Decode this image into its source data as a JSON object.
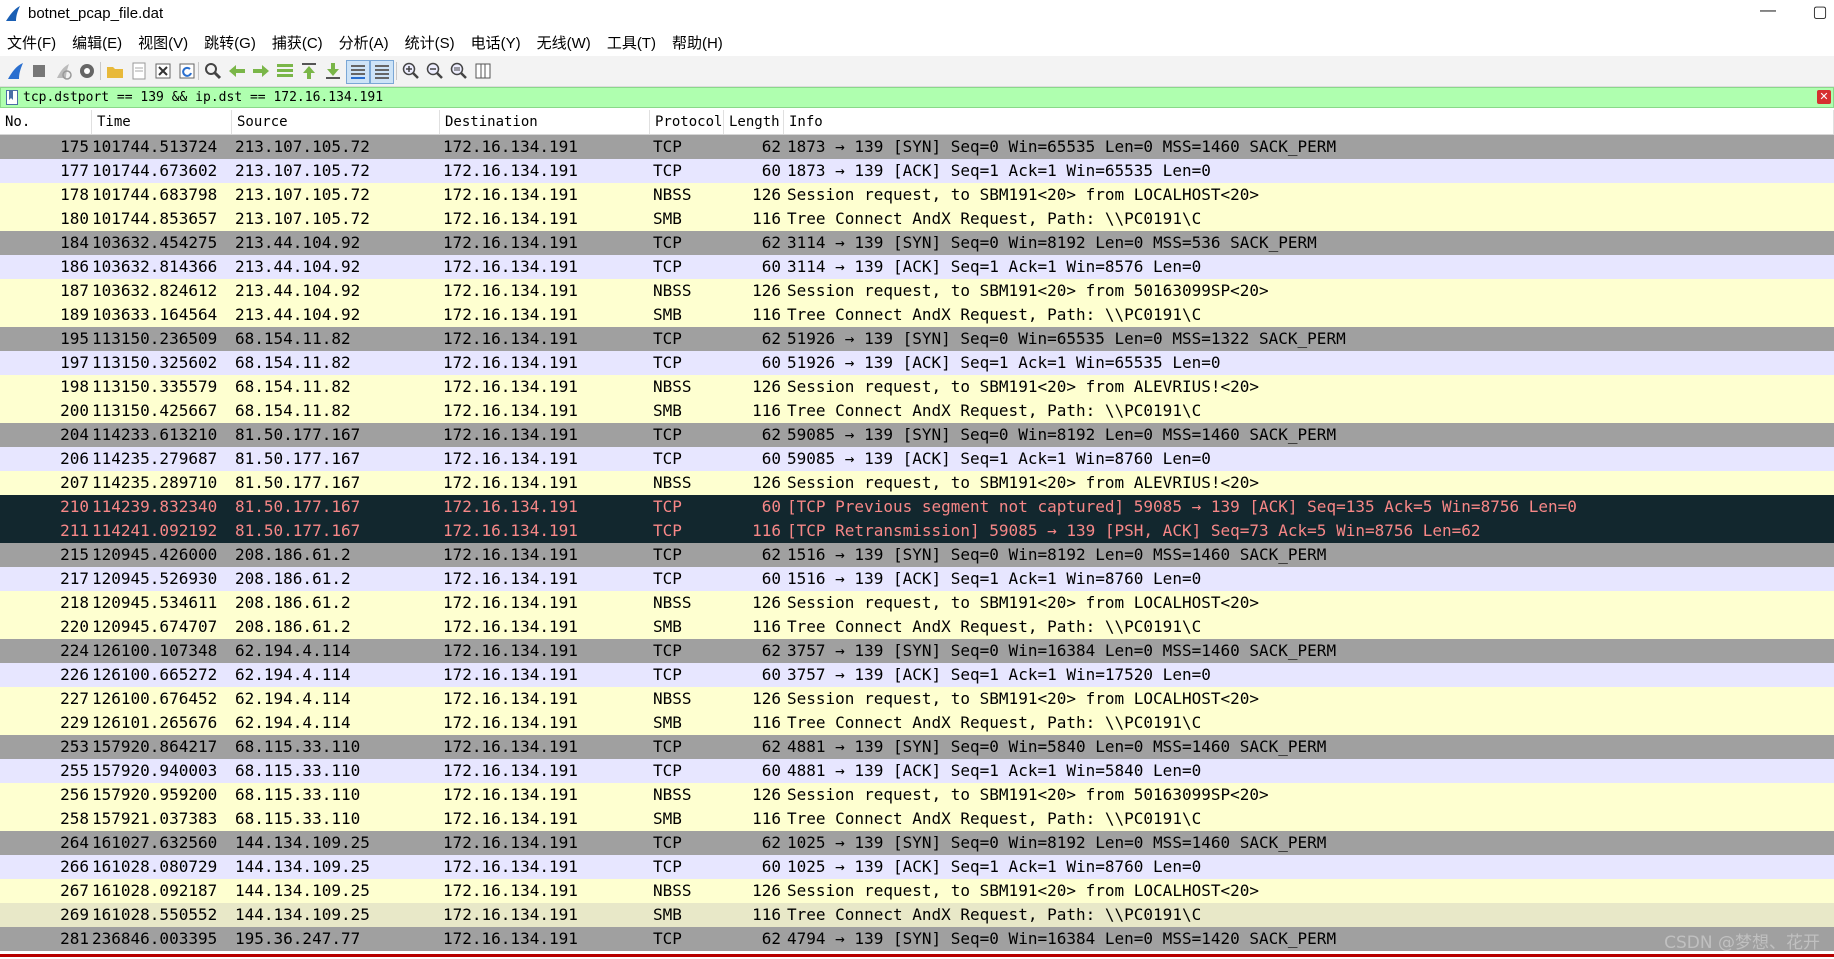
{
  "window": {
    "title": "botnet_pcap_file.dat",
    "minimize": "—",
    "restore": "▢"
  },
  "menu": [
    "文件(F)",
    "编辑(E)",
    "视图(V)",
    "跳转(G)",
    "捕获(C)",
    "分析(A)",
    "统计(S)",
    "电话(Y)",
    "无线(W)",
    "工具(T)",
    "帮助(H)"
  ],
  "filter": {
    "value": "tcp.dstport == 139 && ip.dst == 172.16.134.191"
  },
  "columns": [
    "No.",
    "Time",
    "Source",
    "Destination",
    "Protocol",
    "Length",
    "Info"
  ],
  "colors": {
    "syn_bg": "#a0a0a0",
    "ack_bg": "#e7e6ff",
    "nbss_bg": "#feffd0",
    "smb_bg": "#feffd0",
    "err_bg": "#12272e",
    "err_fg": "#f78787",
    "last_smb_bg": "#e8e8c8",
    "filter_bg": "#afffaf"
  },
  "packets": [
    {
      "no": "175",
      "time": "101744.513724",
      "src": "213.107.105.72",
      "dst": "172.16.134.191",
      "proto": "TCP",
      "len": "62",
      "info": "1873 → 139 [SYN] Seq=0 Win=65535 Len=0 MSS=1460 SACK_PERM",
      "style": "syn"
    },
    {
      "no": "177",
      "time": "101744.673602",
      "src": "213.107.105.72",
      "dst": "172.16.134.191",
      "proto": "TCP",
      "len": "60",
      "info": "1873 → 139 [ACK] Seq=1 Ack=1 Win=65535 Len=0",
      "style": "ack"
    },
    {
      "no": "178",
      "time": "101744.683798",
      "src": "213.107.105.72",
      "dst": "172.16.134.191",
      "proto": "NBSS",
      "len": "126",
      "info": "Session request, to SBM191<20> from LOCALHOST<20>",
      "style": "nbss"
    },
    {
      "no": "180",
      "time": "101744.853657",
      "src": "213.107.105.72",
      "dst": "172.16.134.191",
      "proto": "SMB",
      "len": "116",
      "info": "Tree Connect AndX Request, Path: \\\\PC0191\\C",
      "style": "smb"
    },
    {
      "no": "184",
      "time": "103632.454275",
      "src": "213.44.104.92",
      "dst": "172.16.134.191",
      "proto": "TCP",
      "len": "62",
      "info": "3114 → 139 [SYN] Seq=0 Win=8192 Len=0 MSS=536 SACK_PERM",
      "style": "syn"
    },
    {
      "no": "186",
      "time": "103632.814366",
      "src": "213.44.104.92",
      "dst": "172.16.134.191",
      "proto": "TCP",
      "len": "60",
      "info": "3114 → 139 [ACK] Seq=1 Ack=1 Win=8576 Len=0",
      "style": "ack"
    },
    {
      "no": "187",
      "time": "103632.824612",
      "src": "213.44.104.92",
      "dst": "172.16.134.191",
      "proto": "NBSS",
      "len": "126",
      "info": "Session request, to SBM191<20> from 50163099SP<20>",
      "style": "nbss"
    },
    {
      "no": "189",
      "time": "103633.164564",
      "src": "213.44.104.92",
      "dst": "172.16.134.191",
      "proto": "SMB",
      "len": "116",
      "info": "Tree Connect AndX Request, Path: \\\\PC0191\\C",
      "style": "smb"
    },
    {
      "no": "195",
      "time": "113150.236509",
      "src": "68.154.11.82",
      "dst": "172.16.134.191",
      "proto": "TCP",
      "len": "62",
      "info": "51926 → 139 [SYN] Seq=0 Win=65535 Len=0 MSS=1322 SACK_PERM",
      "style": "syn"
    },
    {
      "no": "197",
      "time": "113150.325602",
      "src": "68.154.11.82",
      "dst": "172.16.134.191",
      "proto": "TCP",
      "len": "60",
      "info": "51926 → 139 [ACK] Seq=1 Ack=1 Win=65535 Len=0",
      "style": "ack"
    },
    {
      "no": "198",
      "time": "113150.335579",
      "src": "68.154.11.82",
      "dst": "172.16.134.191",
      "proto": "NBSS",
      "len": "126",
      "info": "Session request, to SBM191<20> from ALEVRIUS!<20>",
      "style": "nbss"
    },
    {
      "no": "200",
      "time": "113150.425667",
      "src": "68.154.11.82",
      "dst": "172.16.134.191",
      "proto": "SMB",
      "len": "116",
      "info": "Tree Connect AndX Request, Path: \\\\PC0191\\C",
      "style": "smb"
    },
    {
      "no": "204",
      "time": "114233.613210",
      "src": "81.50.177.167",
      "dst": "172.16.134.191",
      "proto": "TCP",
      "len": "62",
      "info": "59085 → 139 [SYN] Seq=0 Win=8192 Len=0 MSS=1460 SACK_PERM",
      "style": "syn"
    },
    {
      "no": "206",
      "time": "114235.279687",
      "src": "81.50.177.167",
      "dst": "172.16.134.191",
      "proto": "TCP",
      "len": "60",
      "info": "59085 → 139 [ACK] Seq=1 Ack=1 Win=8760 Len=0",
      "style": "ack"
    },
    {
      "no": "207",
      "time": "114235.289710",
      "src": "81.50.177.167",
      "dst": "172.16.134.191",
      "proto": "NBSS",
      "len": "126",
      "info": "Session request, to SBM191<20> from ALEVRIUS!<20>",
      "style": "nbss"
    },
    {
      "no": "210",
      "time": "114239.832340",
      "src": "81.50.177.167",
      "dst": "172.16.134.191",
      "proto": "TCP",
      "len": "60",
      "info": "[TCP Previous segment not captured] 59085 → 139 [ACK] Seq=135 Ack=5 Win=8756 Len=0",
      "style": "err"
    },
    {
      "no": "211",
      "time": "114241.092192",
      "src": "81.50.177.167",
      "dst": "172.16.134.191",
      "proto": "TCP",
      "len": "116",
      "info": "[TCP Retransmission] 59085 → 139 [PSH, ACK] Seq=73 Ack=5 Win=8756 Len=62",
      "style": "err"
    },
    {
      "no": "215",
      "time": "120945.426000",
      "src": "208.186.61.2",
      "dst": "172.16.134.191",
      "proto": "TCP",
      "len": "62",
      "info": "1516 → 139 [SYN] Seq=0 Win=8192 Len=0 MSS=1460 SACK_PERM",
      "style": "syn"
    },
    {
      "no": "217",
      "time": "120945.526930",
      "src": "208.186.61.2",
      "dst": "172.16.134.191",
      "proto": "TCP",
      "len": "60",
      "info": "1516 → 139 [ACK] Seq=1 Ack=1 Win=8760 Len=0",
      "style": "ack"
    },
    {
      "no": "218",
      "time": "120945.534611",
      "src": "208.186.61.2",
      "dst": "172.16.134.191",
      "proto": "NBSS",
      "len": "126",
      "info": "Session request, to SBM191<20> from LOCALHOST<20>",
      "style": "nbss"
    },
    {
      "no": "220",
      "time": "120945.674707",
      "src": "208.186.61.2",
      "dst": "172.16.134.191",
      "proto": "SMB",
      "len": "116",
      "info": "Tree Connect AndX Request, Path: \\\\PC0191\\C",
      "style": "smb"
    },
    {
      "no": "224",
      "time": "126100.107348",
      "src": "62.194.4.114",
      "dst": "172.16.134.191",
      "proto": "TCP",
      "len": "62",
      "info": "3757 → 139 [SYN] Seq=0 Win=16384 Len=0 MSS=1460 SACK_PERM",
      "style": "syn"
    },
    {
      "no": "226",
      "time": "126100.665272",
      "src": "62.194.4.114",
      "dst": "172.16.134.191",
      "proto": "TCP",
      "len": "60",
      "info": "3757 → 139 [ACK] Seq=1 Ack=1 Win=17520 Len=0",
      "style": "ack"
    },
    {
      "no": "227",
      "time": "126100.676452",
      "src": "62.194.4.114",
      "dst": "172.16.134.191",
      "proto": "NBSS",
      "len": "126",
      "info": "Session request, to SBM191<20> from LOCALHOST<20>",
      "style": "nbss"
    },
    {
      "no": "229",
      "time": "126101.265676",
      "src": "62.194.4.114",
      "dst": "172.16.134.191",
      "proto": "SMB",
      "len": "116",
      "info": "Tree Connect AndX Request, Path: \\\\PC0191\\C",
      "style": "smb"
    },
    {
      "no": "253",
      "time": "157920.864217",
      "src": "68.115.33.110",
      "dst": "172.16.134.191",
      "proto": "TCP",
      "len": "62",
      "info": "4881 → 139 [SYN] Seq=0 Win=5840 Len=0 MSS=1460 SACK_PERM",
      "style": "syn"
    },
    {
      "no": "255",
      "time": "157920.940003",
      "src": "68.115.33.110",
      "dst": "172.16.134.191",
      "proto": "TCP",
      "len": "60",
      "info": "4881 → 139 [ACK] Seq=1 Ack=1 Win=5840 Len=0",
      "style": "ack"
    },
    {
      "no": "256",
      "time": "157920.959200",
      "src": "68.115.33.110",
      "dst": "172.16.134.191",
      "proto": "NBSS",
      "len": "126",
      "info": "Session request, to SBM191<20> from 50163099SP<20>",
      "style": "nbss"
    },
    {
      "no": "258",
      "time": "157921.037383",
      "src": "68.115.33.110",
      "dst": "172.16.134.191",
      "proto": "SMB",
      "len": "116",
      "info": "Tree Connect AndX Request, Path: \\\\PC0191\\C",
      "style": "smb"
    },
    {
      "no": "264",
      "time": "161027.632560",
      "src": "144.134.109.25",
      "dst": "172.16.134.191",
      "proto": "TCP",
      "len": "62",
      "info": "1025 → 139 [SYN] Seq=0 Win=8192 Len=0 MSS=1460 SACK_PERM",
      "style": "syn"
    },
    {
      "no": "266",
      "time": "161028.080729",
      "src": "144.134.109.25",
      "dst": "172.16.134.191",
      "proto": "TCP",
      "len": "60",
      "info": "1025 → 139 [ACK] Seq=1 Ack=1 Win=8760 Len=0",
      "style": "ack"
    },
    {
      "no": "267",
      "time": "161028.092187",
      "src": "144.134.109.25",
      "dst": "172.16.134.191",
      "proto": "NBSS",
      "len": "126",
      "info": "Session request, to SBM191<20> from LOCALHOST<20>",
      "style": "nbss"
    },
    {
      "no": "269",
      "time": "161028.550552",
      "src": "144.134.109.25",
      "dst": "172.16.134.191",
      "proto": "SMB",
      "len": "116",
      "info": "Tree Connect AndX Request, Path: \\\\PC0191\\C",
      "style": "smb_last"
    },
    {
      "no": "281",
      "time": "236846.003395",
      "src": "195.36.247.77",
      "dst": "172.16.134.191",
      "proto": "TCP",
      "len": "62",
      "info": "4794 → 139 [SYN] Seq=0 Win=16384 Len=0 MSS=1420 SACK_PERM",
      "style": "syn"
    }
  ],
  "watermark": "CSDN @梦想、花开"
}
